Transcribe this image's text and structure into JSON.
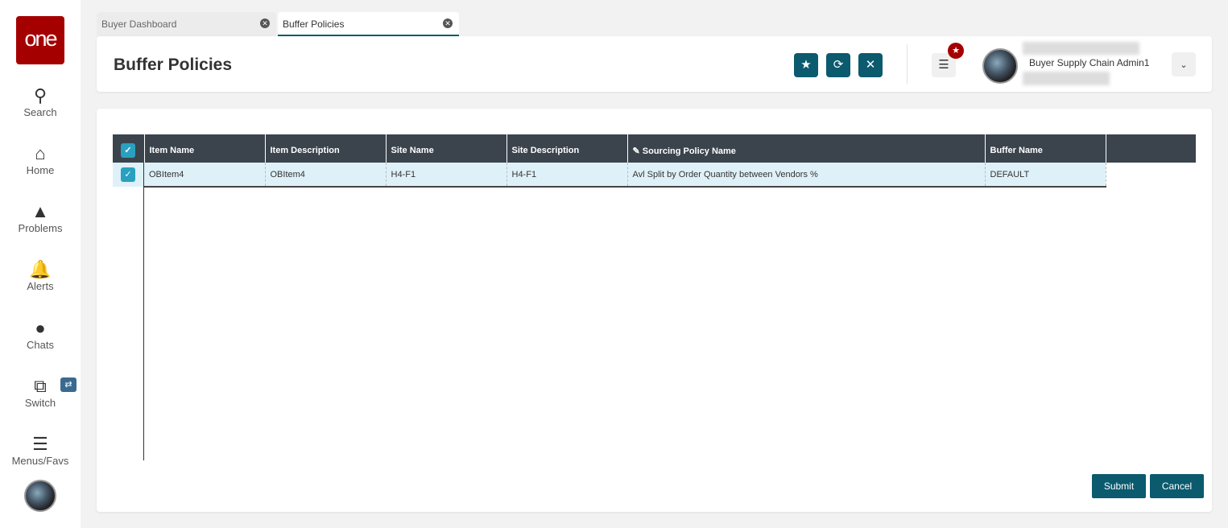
{
  "logo": "one",
  "sidebar": {
    "items": [
      {
        "label": "Search",
        "icon": "search-icon"
      },
      {
        "label": "Home",
        "icon": "home-icon"
      },
      {
        "label": "Problems",
        "icon": "warning-icon"
      },
      {
        "label": "Alerts",
        "icon": "bell-icon"
      },
      {
        "label": "Chats",
        "icon": "chat-icon"
      },
      {
        "label": "Switch",
        "icon": "switch-icon"
      },
      {
        "label": "Menus/Favs",
        "icon": "menu-icon"
      }
    ]
  },
  "tabs": [
    {
      "label": "Buyer Dashboard"
    },
    {
      "label": "Buffer Policies"
    }
  ],
  "header": {
    "title": "Buffer Policies",
    "user_role": "Buyer Supply Chain Admin1"
  },
  "table": {
    "columns": [
      "Item Name",
      "Item Description",
      "Site Name",
      "Site Description",
      "Sourcing Policy Name",
      "Buffer Name"
    ],
    "rows": [
      [
        "OBItem4",
        "OBItem4",
        "H4-F1",
        "H4-F1",
        "Avl Split by Order Quantity between Vendors %",
        "DEFAULT"
      ]
    ]
  },
  "footer": {
    "submit": "Submit",
    "cancel": "Cancel"
  },
  "colors": {
    "accent": "#0b5a6e",
    "brand": "#a50000",
    "header_bg": "#3b434d",
    "row_bg": "#dff1f8"
  }
}
